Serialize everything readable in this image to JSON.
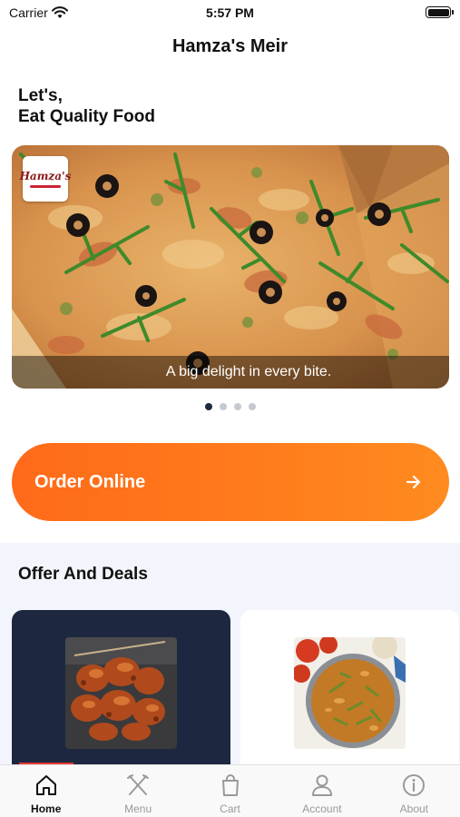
{
  "status_bar": {
    "carrier": "Carrier",
    "time": "5:57 PM",
    "battery_level": 1.0
  },
  "nav": {
    "title": "Hamza's Meir"
  },
  "greeting": {
    "line1": "Let's,",
    "line2": "Eat Quality Food"
  },
  "banner": {
    "caption": "A big delight in every bite.",
    "logo_text": "Hamza's",
    "slides": 4,
    "active_slide": 1
  },
  "order_button": {
    "label": "Order Online",
    "icon": "arrow-right-icon"
  },
  "offers": {
    "title": "Offer And Deals",
    "cards": [
      {
        "name": "offer-card-chicken-tikka",
        "background": "#1d2840"
      },
      {
        "name": "offer-card-curry",
        "background": "#ffffff"
      }
    ]
  },
  "tabbar": {
    "items": [
      {
        "label": "Home",
        "icon": "home-icon",
        "active": true
      },
      {
        "label": "Menu",
        "icon": "utensils-icon",
        "active": false
      },
      {
        "label": "Cart",
        "icon": "shopping-bag-icon",
        "active": false
      },
      {
        "label": "Account",
        "icon": "person-icon",
        "active": false
      },
      {
        "label": "About",
        "icon": "info-icon",
        "active": false
      }
    ]
  },
  "colors": {
    "accent": "#ff7a1c",
    "dark": "#1d2840",
    "section_bg": "#f2f5fb"
  }
}
